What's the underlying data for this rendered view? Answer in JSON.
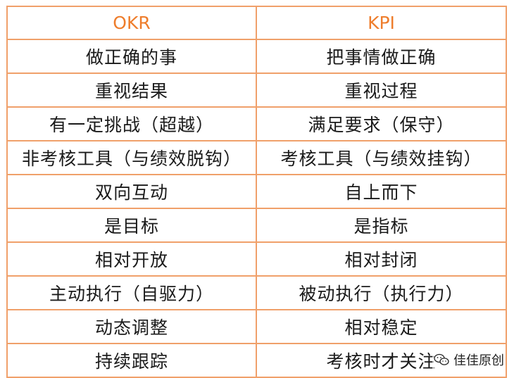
{
  "table": {
    "headers": [
      "OKR",
      "KPI"
    ],
    "rows": [
      [
        "做正确的事",
        "把事情做正确"
      ],
      [
        "重视结果",
        "重视过程"
      ],
      [
        "有一定挑战（超越）",
        "满足要求（保守）"
      ],
      [
        "非考核工具（与绩效脱钩）",
        "考核工具（与绩效挂钩）"
      ],
      [
        "双向互动",
        "自上而下"
      ],
      [
        "是目标",
        "是指标"
      ],
      [
        "相对开放",
        "相对封闭"
      ],
      [
        "主动执行（自驱力）",
        "被动执行（执行力）"
      ],
      [
        "动态调整",
        "相对稳定"
      ],
      [
        "持续跟踪",
        "考核时才关注"
      ]
    ]
  },
  "watermark": {
    "text": "佳佳原创",
    "icon": "wechat-chat-icon"
  },
  "colors": {
    "border": "#f0a06a",
    "header_text": "#ee7d2c",
    "body_text": "#1a1a1a"
  }
}
